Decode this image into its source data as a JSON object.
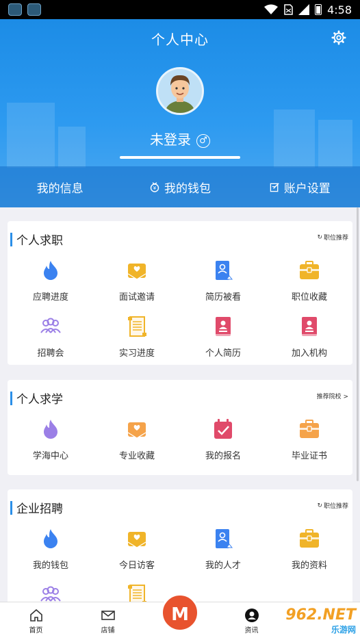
{
  "status": {
    "time": "4:58"
  },
  "header": {
    "title": "个人中心",
    "username": "未登录",
    "gender_symbol": "♂",
    "tabs": [
      {
        "label": "我的信息",
        "icon": ""
      },
      {
        "label": "我的钱包",
        "icon": "money-bag-icon"
      },
      {
        "label": "账户设置",
        "icon": "edit-icon"
      }
    ]
  },
  "sections": {
    "jobs": {
      "title": "个人求职",
      "link": "职位推荐",
      "items": [
        {
          "label": "应聘进度",
          "icon": "flame-icon",
          "color": "#3b82f0"
        },
        {
          "label": "面试邀请",
          "icon": "mail-heart-icon",
          "color": "#f0b429"
        },
        {
          "label": "简历被看",
          "icon": "contact-card-icon",
          "color": "#3b82f0"
        },
        {
          "label": "职位收藏",
          "icon": "briefcase-icon",
          "color": "#f0b429"
        },
        {
          "label": "招聘会",
          "icon": "people-icon",
          "color": "#9b7fe6"
        },
        {
          "label": "实习进度",
          "icon": "scroll-icon",
          "color": "#f0b429"
        },
        {
          "label": "个人简历",
          "icon": "resume-book-icon",
          "color": "#e04a6a"
        },
        {
          "label": "加入机构",
          "icon": "resume-book-icon",
          "color": "#e04a6a"
        }
      ]
    },
    "study": {
      "title": "个人求学",
      "link": "推荐院校 >",
      "items": [
        {
          "label": "学海中心",
          "icon": "flame-icon",
          "color": "#9b7fe6"
        },
        {
          "label": "专业收藏",
          "icon": "mail-heart-icon",
          "color": "#f5a34a"
        },
        {
          "label": "我的报名",
          "icon": "calendar-check-icon",
          "color": "#e04a6a"
        },
        {
          "label": "毕业证书",
          "icon": "briefcase-icon",
          "color": "#f5a34a"
        }
      ]
    },
    "enterprise": {
      "title": "企业招聘",
      "link": "职位推荐",
      "items": [
        {
          "label": "我的钱包",
          "icon": "flame-icon",
          "color": "#3b82f0"
        },
        {
          "label": "今日访客",
          "icon": "mail-heart-icon",
          "color": "#f0b429"
        },
        {
          "label": "我的人才",
          "icon": "contact-card-icon",
          "color": "#3b82f0"
        },
        {
          "label": "我的资料",
          "icon": "briefcase-icon",
          "color": "#f0b429"
        },
        {
          "label": "",
          "icon": "people-icon",
          "color": "#9b7fe6"
        },
        {
          "label": "",
          "icon": "scroll-icon",
          "color": "#f0b429"
        }
      ]
    }
  },
  "bottom_nav": {
    "items": [
      {
        "label": "首页",
        "icon": "home-icon"
      },
      {
        "label": "店铺",
        "icon": "mail-icon"
      },
      {
        "label": "",
        "icon": ""
      },
      {
        "label": "资讯",
        "icon": "person-circle-icon"
      }
    ],
    "center_label": "M"
  },
  "watermark": {
    "brand": "962.NET",
    "sub": "乐游网"
  }
}
